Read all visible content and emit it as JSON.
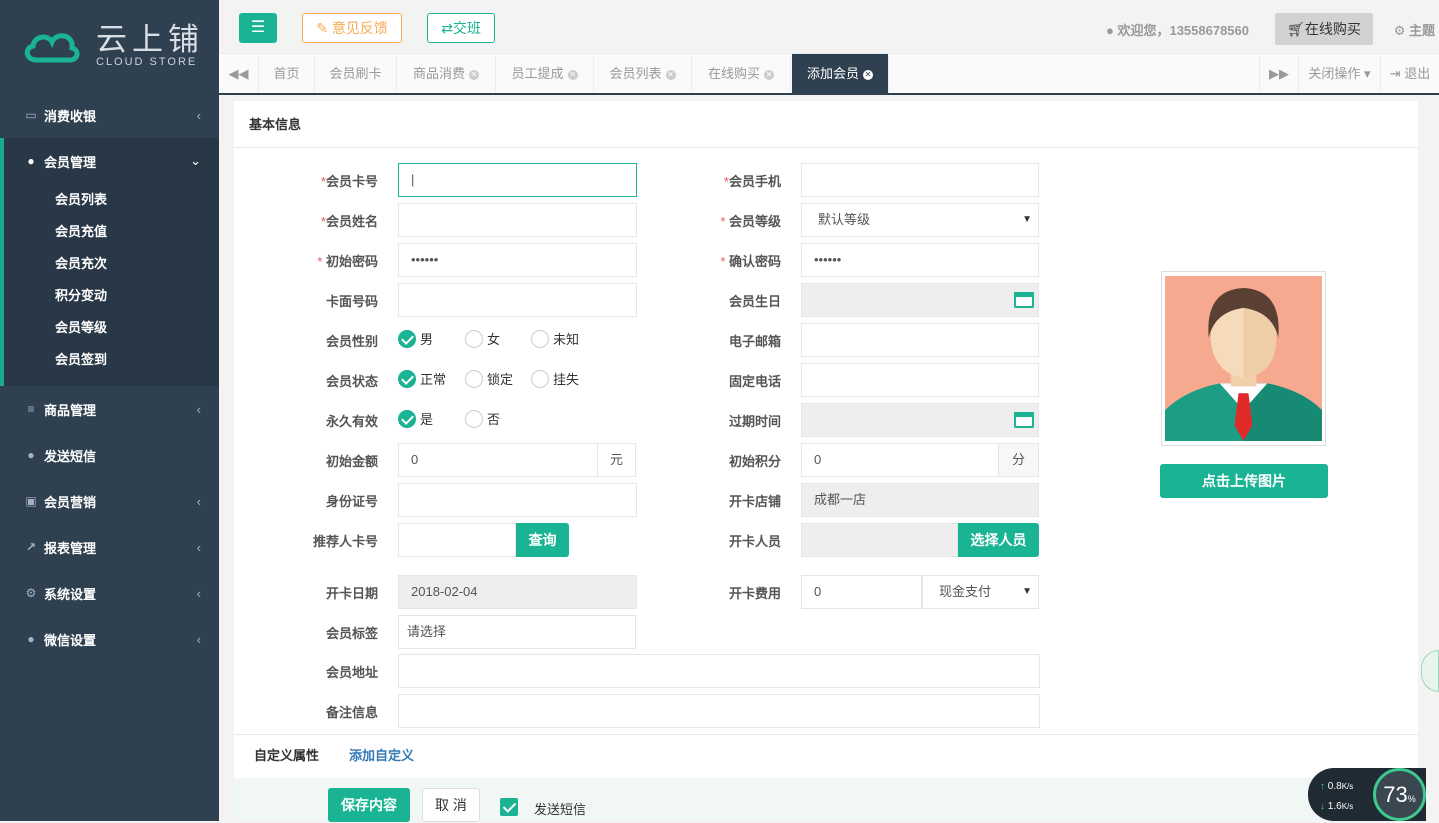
{
  "brand": {
    "cn": "云上铺",
    "en": "CLOUD STORE",
    "accent": "#1ab394",
    "sidebar_bg": "#2f4050"
  },
  "sidebar": {
    "items": [
      {
        "label": "消费收银",
        "icon": "credit-card-icon"
      },
      {
        "label": "会员管理",
        "icon": "user-icon"
      },
      {
        "label": "商品管理",
        "icon": "database-icon"
      },
      {
        "label": "发送短信",
        "icon": "comment-icon"
      },
      {
        "label": "会员营销",
        "icon": "briefcase-icon"
      },
      {
        "label": "报表管理",
        "icon": "line-chart-icon"
      },
      {
        "label": "系统设置",
        "icon": "cogs-icon"
      },
      {
        "label": "微信设置",
        "icon": "comments-icon"
      }
    ],
    "subitems": [
      "会员列表",
      "会员充值",
      "会员充次",
      "积分变动",
      "会员等级",
      "会员签到"
    ]
  },
  "top": {
    "feedback": "意见反馈",
    "shift": "交班",
    "welcome": "欢迎您，13558678560",
    "buy": "在线购买",
    "theme": "主题"
  },
  "tabs": [
    "首页",
    "会员刷卡",
    "商品消费",
    "员工提成",
    "会员列表",
    "在线购买",
    "添加会员"
  ],
  "tab_actions": {
    "close_ops": "关闭操作",
    "logout": "退出"
  },
  "form": {
    "section_title": "基本信息",
    "card_no": "会员卡号",
    "mobile": "会员手机",
    "name": "会员姓名",
    "level": "会员等级",
    "level_value": "默认等级",
    "init_pwd": "初始密码",
    "confirm_pwd": "确认密码",
    "pwd_mask": "••••••",
    "face_no": "卡面号码",
    "birthday": "会员生日",
    "gender": "会员性别",
    "gender_opts": [
      "男",
      "女",
      "未知"
    ],
    "email": "电子邮箱",
    "status": "会员状态",
    "status_opts": [
      "正常",
      "锁定",
      "挂失"
    ],
    "phone": "固定电话",
    "permanent": "永久有效",
    "permanent_opts": [
      "是",
      "否"
    ],
    "expire": "过期时间",
    "init_amount": "初始金额",
    "amount_value": "0",
    "amount_unit": "元",
    "init_points": "初始积分",
    "points_value": "0",
    "points_unit": "分",
    "id_no": "身份证号",
    "store": "开卡店铺",
    "store_value": "成都一店",
    "referrer": "推荐人卡号",
    "query": "查询",
    "staff": "开卡人员",
    "choose_staff": "选择人员",
    "open_date": "开卡日期",
    "open_date_value": "2018-02-04",
    "fee": "开卡费用",
    "fee_value": "0",
    "pay_method": "现金支付",
    "tag": "会员标签",
    "tag_placeholder": "请选择",
    "address": "会员地址",
    "remark": "备注信息"
  },
  "upload": "点击上传图片",
  "custom": {
    "label": "自定义属性",
    "add": "添加自定义"
  },
  "footer": {
    "save": "保存内容",
    "cancel": "取 消",
    "sms": "发送短信"
  },
  "speed": {
    "up": "0.8",
    "down": "1.6",
    "unit": "K/s",
    "percent": "73"
  }
}
